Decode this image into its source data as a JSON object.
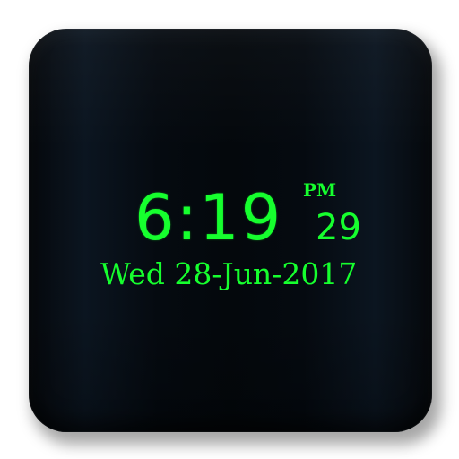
{
  "clock": {
    "time": "6:19",
    "ampm": "PM",
    "seconds": "29",
    "date": "Wed 28-Jun-2017"
  },
  "colors": {
    "digit_green": "#16ff2e",
    "tile_dark": "#05090e"
  }
}
